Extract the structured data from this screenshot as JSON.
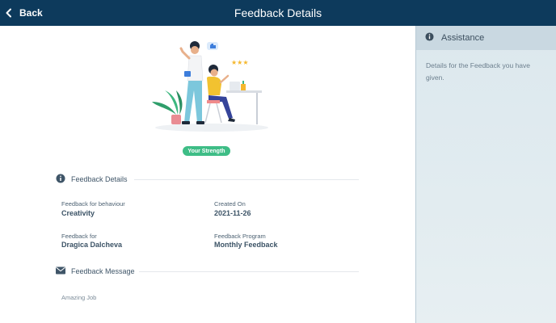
{
  "header": {
    "back_label": "Back",
    "title": "Feedback Details"
  },
  "illustration": {
    "badge": "Your Strength"
  },
  "details_section": {
    "heading": "Feedback Details",
    "fields": [
      {
        "label": "Feedback for behaviour",
        "value": "Creativity"
      },
      {
        "label": "Created On",
        "value": "2021-11-26"
      },
      {
        "label": "Feedback for",
        "value": "Dragica Dalcheva"
      },
      {
        "label": "Feedback Program",
        "value": "Monthly Feedback"
      }
    ]
  },
  "message_section": {
    "heading": "Feedback Message",
    "text": "Amazing Job"
  },
  "assistance": {
    "heading": "Assistance",
    "text": "Details for the Feedback you have given."
  },
  "colors": {
    "header_bg": "#0d3a5c",
    "badge_bg": "#3ebd86",
    "sidebar_bg": "#dce8ee"
  },
  "icons": {
    "back": "chevron-left-icon",
    "info": "info-icon",
    "message": "envelope-icon"
  }
}
